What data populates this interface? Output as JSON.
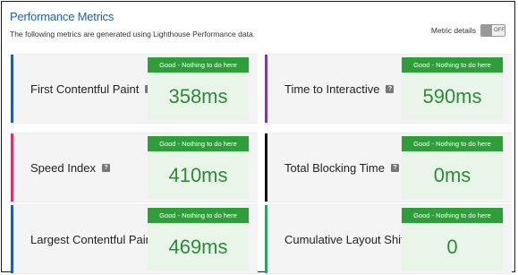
{
  "header": {
    "title": "Performance Metrics",
    "subtitle": "The following metrics are generated using Lighthouse Performance data.",
    "details_label": "Metric details",
    "toggle_text": "OFF"
  },
  "colors": {
    "title": "#1f63a8",
    "status_green": "#2e9e3a",
    "value_green": "#2a8c35",
    "value_bg": "#eaf5ea"
  },
  "metrics": [
    {
      "label": "First Contentful Paint",
      "status": "Good - Nothing to do here",
      "value": "358ms",
      "accent": "#1e5fa8",
      "help": "?"
    },
    {
      "label": "Time to Interactive",
      "status": "Good - Nothing to do here",
      "value": "590ms",
      "accent": "#7b3b98",
      "help": "?"
    },
    {
      "label": "Speed Index",
      "status": "Good - Nothing to do here",
      "value": "410ms",
      "accent": "#d6336c",
      "help": "?"
    },
    {
      "label": "Total Blocking Time",
      "status": "Good - Nothing to do here",
      "value": "0ms",
      "accent": "#111111",
      "help": "?"
    },
    {
      "label": "Largest Contentful Paint",
      "status": "Good - Nothing to do here",
      "value": "469ms",
      "accent": "#1e5fa8",
      "help": "?"
    },
    {
      "label": "Cumulative Layout Shift",
      "status": "Good - Nothing to do here",
      "value": "0",
      "accent": "#2e9e6a",
      "help": "?"
    }
  ]
}
